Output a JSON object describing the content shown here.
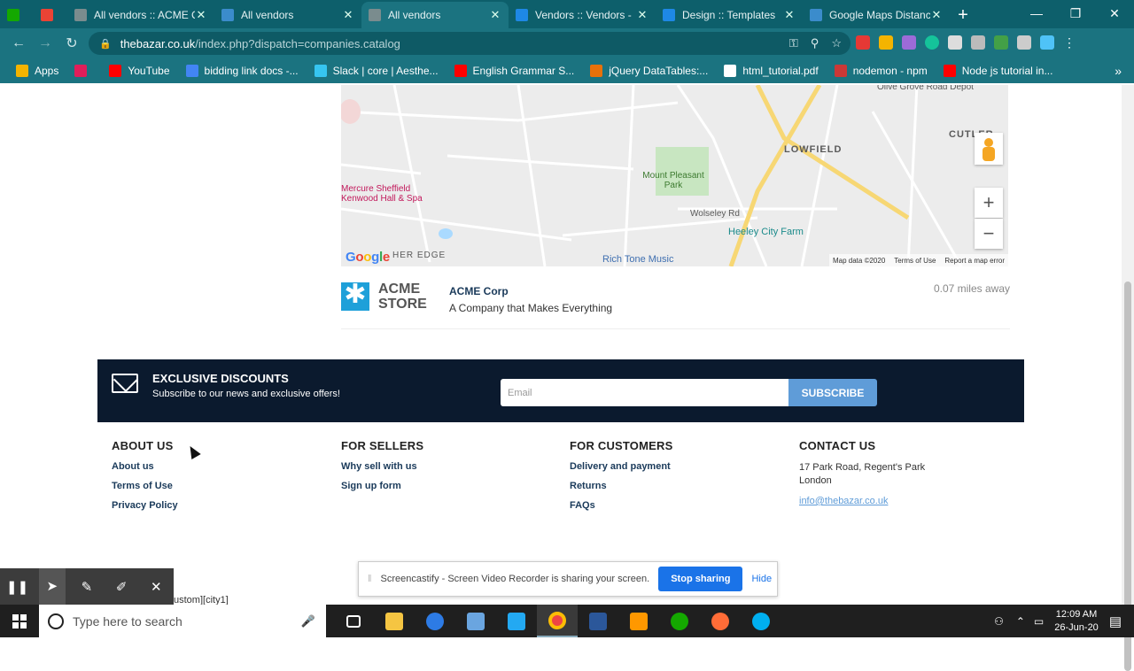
{
  "browser": {
    "tabs": [
      {
        "label": "",
        "icon": "upwork-icon",
        "color": "#14a800"
      },
      {
        "label": "",
        "icon": "gmail-icon",
        "color": "#ea4335"
      },
      {
        "label": "All vendors :: ACME C",
        "icon": "b-icon",
        "color": "#7a8c8e"
      },
      {
        "label": "All vendors",
        "icon": "globe-icon",
        "color": "#3b8ccc"
      },
      {
        "label": "All vendors",
        "icon": "b-icon",
        "color": "#7a8c8e",
        "active": true
      },
      {
        "label": "Vendors :: Vendors -",
        "icon": "gear-icon",
        "color": "#1e88e5"
      },
      {
        "label": "Design :: Templates",
        "icon": "gear-icon",
        "color": "#1e88e5"
      },
      {
        "label": "Google Maps Distanc",
        "icon": "globe-icon",
        "color": "#3b8ccc"
      }
    ],
    "new_tab": "+",
    "url_host": "thebazar.co.uk",
    "url_path": "/index.php?dispatch=companies.catalog",
    "bookmarks": [
      {
        "label": "Apps",
        "color": "#f4b400"
      },
      {
        "label": "",
        "color": "#e01e5a"
      },
      {
        "label": "YouTube",
        "color": "#ff0000"
      },
      {
        "label": "bidding link docs -...",
        "color": "#4285f4"
      },
      {
        "label": "Slack | core | Aesthe...",
        "color": "#36c5f0"
      },
      {
        "label": "English Grammar S...",
        "color": "#ff0000"
      },
      {
        "label": "jQuery DataTables:...",
        "color": "#e8710a"
      },
      {
        "label": "html_tutorial.pdf",
        "color": "#ffffff"
      },
      {
        "label": "nodemon - npm",
        "color": "#cb3837"
      },
      {
        "label": "Node js tutorial in...",
        "color": "#ff0000"
      }
    ],
    "bookmarks_more": "»"
  },
  "map": {
    "labels": [
      {
        "text": "Olive Grove Road Depot"
      },
      {
        "text": "LOWFIELD"
      },
      {
        "text": "CUTLER"
      },
      {
        "text": "Mount Pleasant Park"
      },
      {
        "text": "Mercure Sheffield Kenwood Hall & Spa"
      },
      {
        "text": "Heeley City Farm"
      },
      {
        "text": "Rich Tone Music"
      },
      {
        "text": "Wolseley Rd"
      },
      {
        "text": "HER EDGE"
      }
    ],
    "footer": {
      "data": "Map data ©2020",
      "terms": "Terms of Use",
      "report": "Report a map error"
    },
    "google": "Google"
  },
  "vendor": {
    "logo_line1": "ACME",
    "logo_line2": "STORE",
    "name": "ACME Corp",
    "description": "A Company that Makes Everything",
    "distance": "0.07 miles away"
  },
  "promo": {
    "title": "EXCLUSIVE DISCOUNTS",
    "subtitle": "Subscribe to our news and exclusive offers!",
    "email_placeholder": "Email",
    "button": "SUBSCRIBE"
  },
  "footer": {
    "about": {
      "title": "ABOUT US",
      "links": [
        "About us",
        "Terms of Use",
        "Privacy Policy"
      ]
    },
    "sellers": {
      "title": "FOR SELLERS",
      "links": [
        "Why sell with us",
        "Sign up form"
      ]
    },
    "customers": {
      "title": "FOR CUSTOMERS",
      "links": [
        "Delivery and payment",
        "Returns",
        "FAQs"
      ]
    },
    "contact": {
      "title": "CONTACT US",
      "address1": "17 Park Road, Regent's Park",
      "address2": "London",
      "email": "info@thebazar.co.uk"
    }
  },
  "screencastify": {
    "message": "Screencastify - Screen Video Recorder is sharing your screen.",
    "stop": "Stop sharing",
    "hide": "Hide"
  },
  "bg_text": "ustom][city1]",
  "taskbar": {
    "search_placeholder": "Type here to search",
    "time": "12:09 AM",
    "date": "26-Jun-20"
  }
}
